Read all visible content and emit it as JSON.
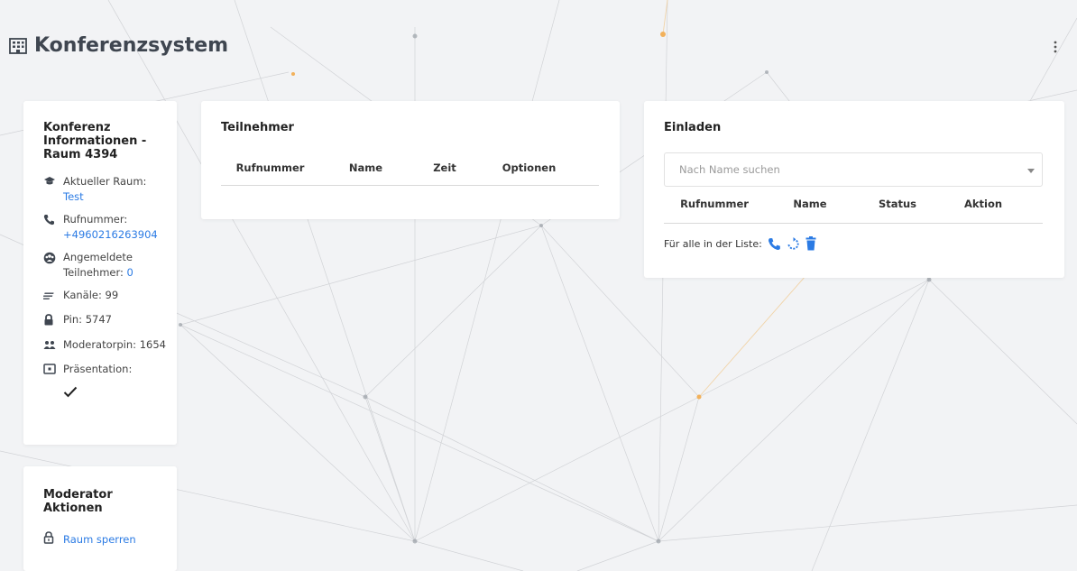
{
  "header": {
    "title": "Konferenzsystem"
  },
  "info": {
    "title": "Konferenz Informationen - Raum 4394",
    "current_room_label": "Aktueller Raum:",
    "current_room_value": "Test",
    "phone_label": "Rufnummer:",
    "phone_value": "+4960216263904",
    "registered_label": "Angemeldete Teilnehmer:",
    "registered_value": "0",
    "channels": "Kanäle: 99",
    "pin": "Pin: 5747",
    "moderator_pin": "Moderatorpin: 1654",
    "presentation_label": "Präsentation:"
  },
  "moderator": {
    "title": "Moderator Aktionen",
    "lock_room": "Raum sperren"
  },
  "participants": {
    "title": "Teilnehmer",
    "columns": [
      "Rufnummer",
      "Name",
      "Zeit",
      "Optionen"
    ]
  },
  "invite": {
    "title": "Einladen",
    "search_placeholder": "Nach Name suchen",
    "columns": [
      "Rufnummer",
      "Name",
      "Status",
      "Aktion"
    ],
    "all_in_list": "Für alle in der Liste:"
  },
  "colors": {
    "accent": "#2b7be4",
    "header_text": "#3f4650"
  },
  "icons": {
    "title": "building-icon",
    "menu": "vertical-dots-icon",
    "room": "graduation-cap-icon",
    "phone": "phone-icon",
    "registered": "users-circle-icon",
    "channels": "list-icon",
    "pin": "lock-icon",
    "moderator_pin": "users-icon",
    "presentation": "presentation-icon",
    "check": "check-icon",
    "lock_room": "unlock-icon",
    "call_all": "phone-icon",
    "redial_all": "refresh-icon",
    "delete_all": "trash-icon"
  }
}
